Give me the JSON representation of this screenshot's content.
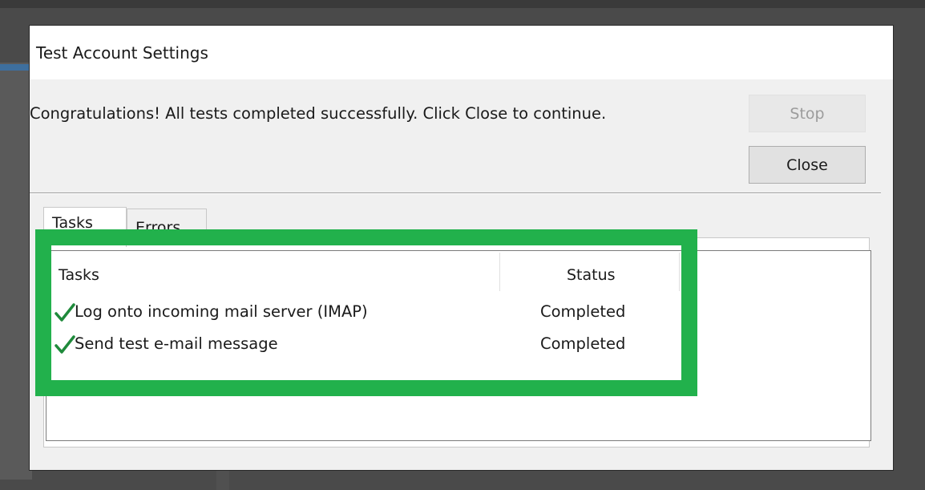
{
  "dialog": {
    "title": "Test Account Settings",
    "message": "Congratulations! All tests completed successfully. Click Close to continue.",
    "buttons": {
      "stop_label": "Stop",
      "close_label": "Close"
    }
  },
  "tabs": [
    {
      "label": "Tasks",
      "selected": true
    },
    {
      "label": "Errors",
      "selected": false
    }
  ],
  "table": {
    "columns": [
      "Tasks",
      "Status"
    ],
    "rows": [
      {
        "task": "Log onto incoming mail server (IMAP)",
        "status": "Completed",
        "icon": "checkmark-icon"
      },
      {
        "task": "Send test e-mail message",
        "status": "Completed",
        "icon": "checkmark-icon"
      }
    ]
  },
  "colors": {
    "highlight": "#22b14c",
    "checkmark": "#1f8a3b"
  }
}
